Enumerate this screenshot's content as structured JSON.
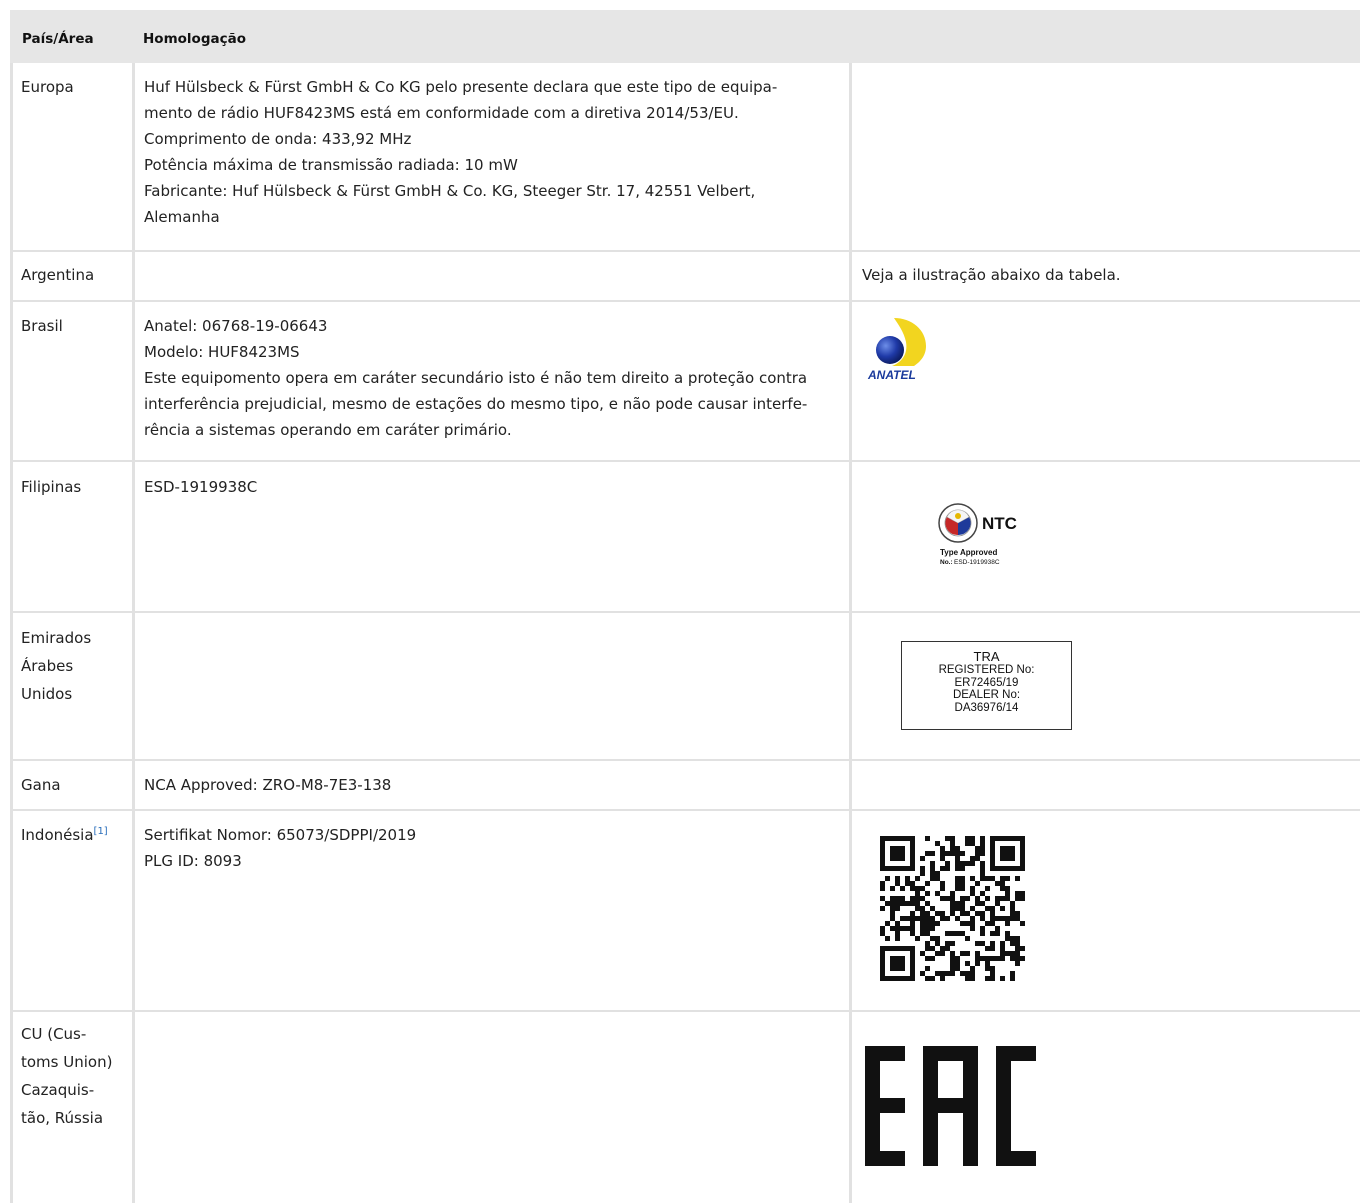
{
  "header": {
    "col_country": "País/Área",
    "col_approval": "Homologação"
  },
  "rows": [
    {
      "country": "Europa",
      "lines": [
        "Huf Hülsbeck & Fürst GmbH & Co KG pelo presente declara que este tipo de equipa-",
        "mento de rádio HUF8423MS está em conformidade com a diretiva 2014/53/EU.",
        "Comprimento de onda: 433,92 MHz",
        "Potência máxima de transmissão radiada: 10 mW",
        "Fabricante: Huf Hülsbeck & Fürst GmbH & Co. KG, Steeger Str. 17, 42551 Velbert,",
        "Alemanha"
      ]
    },
    {
      "country": "Argentina",
      "mark_text": "Veja a ilustração abaixo da tabela."
    },
    {
      "country": "Brasil",
      "lines": [
        "Anatel: 06768-19-06643",
        "Modelo: HUF8423MS",
        "Este equipomento opera em caráter secundário isto é não tem direito a proteção contra",
        "interferência prejudicial, mesmo de estações do mesmo tipo, e não pode causar interfe-",
        "rência a sistemas operando em caráter primário."
      ],
      "logo_text": "ANATEL"
    },
    {
      "country": "Filipinas",
      "lines": [
        "ESD-1919938C"
      ],
      "ntc": {
        "name": "NTC",
        "type_approved": "Type Approved",
        "no_label": "No.:",
        "no_value": "ESD-1919938C"
      }
    },
    {
      "country_lines": [
        "Emirados",
        "Árabes",
        "Unidos"
      ],
      "tra": [
        "TRA",
        "REGISTERED No:",
        "ER72465/19",
        "DEALER No:",
        "DA36976/14"
      ]
    },
    {
      "country": "Gana",
      "lines": [
        "NCA Approved: ZRO-M8-7E3-138"
      ]
    },
    {
      "country": "Indonésia",
      "footnote": "[1]",
      "lines": [
        "Sertifikat Nomor: 65073/SDPPI/2019",
        "PLG ID: 8093"
      ]
    },
    {
      "country_lines": [
        "CU (Cus-",
        "toms Union)",
        "Cazaquis-",
        "tão, Rússia"
      ],
      "eac_text": "EAC"
    }
  ]
}
